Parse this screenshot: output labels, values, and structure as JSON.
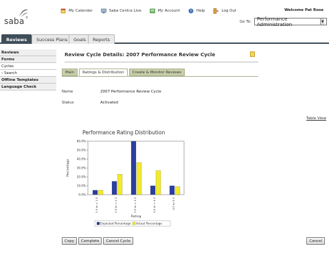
{
  "header": {
    "logo": "saba",
    "logo_mark": "®",
    "nav": [
      {
        "label_italic": "My",
        "label": "Calendar",
        "icon": "calendar-icon"
      },
      {
        "label_italic": "",
        "label": "Saba Centra Live",
        "icon": "centra-icon"
      },
      {
        "label_italic": "My",
        "label": "Account",
        "icon": "account-icon"
      },
      {
        "label_italic": "",
        "label": "Help",
        "icon": "help-icon"
      },
      {
        "label_italic": "",
        "label": "Log Out",
        "icon": "logout-icon"
      }
    ],
    "welcome": "Welcome Pat Rose",
    "goto_label": "Go To:",
    "goto_value": "Performance Administration"
  },
  "tabs": [
    {
      "label": "Reviews",
      "active": true
    },
    {
      "label": "Success Plans",
      "active": false
    },
    {
      "label": "Goals",
      "active": false
    },
    {
      "label": "Reports",
      "active": false
    }
  ],
  "sidebar": [
    {
      "label": "Reviews",
      "style": "bold"
    },
    {
      "label": "Forms",
      "style": "bold"
    },
    {
      "label": "Cycles",
      "style": "plain"
    },
    {
      "label": "› Search",
      "style": "sub"
    },
    {
      "label": "Offline Templates",
      "style": "bold"
    },
    {
      "label": "Language Check",
      "style": "bold"
    }
  ],
  "main": {
    "title": "Review Cycle Details: 2007 Performance Review Cycle",
    "subtabs": [
      {
        "label": "Main",
        "active": false
      },
      {
        "label": "Ratings & Distribution",
        "active": true
      },
      {
        "label": "Create & Monitor Reviews",
        "active": false
      }
    ],
    "fields": [
      {
        "label": "Name",
        "value": "2007 Performance Review Cycle"
      },
      {
        "label": "Status",
        "value": "Activated"
      }
    ],
    "table_view": "Table View",
    "buttons": [
      "Copy",
      "Complete",
      "Cancel Cycle"
    ],
    "cancel": "Cancel"
  },
  "chart_data": {
    "type": "bar",
    "title": "Performance Rating Distribution",
    "xlabel": "Rating",
    "ylabel": "Percentage",
    "ylim": [
      0,
      60
    ],
    "yticks": [
      "0.0%",
      "10.0%",
      "20.0%",
      "30.0%",
      "40.0%",
      "50.0%",
      "60.0%"
    ],
    "categories": [
      "1.0 to < 1.5",
      "1.5 to < 2.0",
      "2.5 to < 3.0",
      "3.5 to < 4.0",
      "4.5 to 5.0"
    ],
    "series": [
      {
        "name": "Expected Percentage",
        "color": "#2b3fa0",
        "values": [
          5,
          15,
          60,
          10,
          10
        ]
      },
      {
        "name": "Actual Percentage",
        "color": "#f2ea2c",
        "values": [
          5,
          23,
          36,
          27,
          9
        ]
      }
    ],
    "legend": "bottom",
    "grid": false
  }
}
